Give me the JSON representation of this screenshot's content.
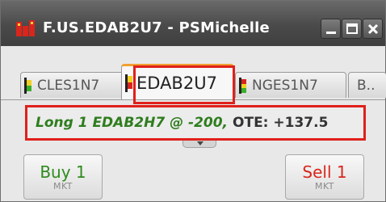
{
  "window": {
    "title": "F.US.EDAB2U7 - PSMichelle"
  },
  "tabs": [
    {
      "label": "CLES1N7",
      "icon": "bar-icon-yellow-green"
    },
    {
      "label": "EDAB2U7",
      "icon": "bar-icon-red-yellow",
      "active": true
    },
    {
      "label": "NGES1N7",
      "icon": "bar-icon-red-green"
    },
    {
      "label": "B..",
      "icon": ""
    }
  ],
  "position": {
    "summary": "Long 1 EDAB2H7 @ -200,",
    "ote": "OTE: +137.5"
  },
  "buy": {
    "label": "Buy 1",
    "type": "MKT"
  },
  "sell": {
    "label": "Sell 1",
    "type": "MKT"
  },
  "colors": {
    "highlight": "#e0201b",
    "long_text": "#2e7d1e",
    "buy": "#2e8b1e",
    "sell": "#d9261c",
    "active_tab_accent": "#f0a030"
  }
}
